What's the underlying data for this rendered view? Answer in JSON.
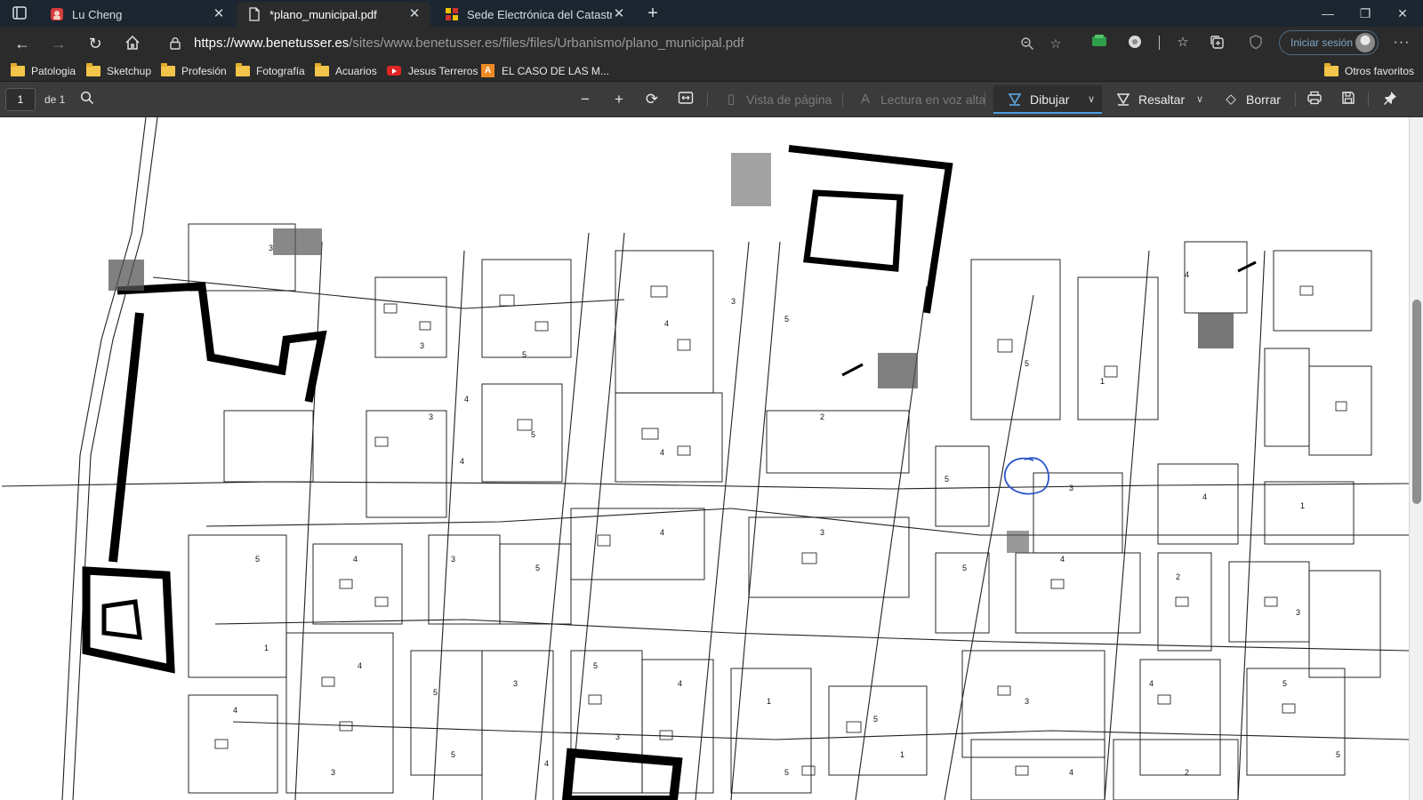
{
  "tabs": [
    {
      "title": "Lu Cheng",
      "favicon": "profile-favicon",
      "active": false
    },
    {
      "title": "*plano_municipal.pdf",
      "favicon": "document-favicon",
      "active": true
    },
    {
      "title": "Sede Electrónica del Catastro - I",
      "favicon": "catastro-favicon",
      "active": false
    }
  ],
  "address": {
    "host": "https://www.benetusser.es",
    "path": "/sites/www.benetusser.es/files/files/Urbanismo/plano_municipal.pdf"
  },
  "profile": {
    "signin_label": "Iniciar sesión"
  },
  "favorites": [
    {
      "label": "Patologia",
      "icon": "folder-icon"
    },
    {
      "label": "Sketchup",
      "icon": "folder-icon"
    },
    {
      "label": "Profesión",
      "icon": "folder-icon"
    },
    {
      "label": "Fotografía",
      "icon": "folder-icon"
    },
    {
      "label": "Acuarios",
      "icon": "folder-icon"
    },
    {
      "label": "Jesus Terreros",
      "icon": "youtube-icon"
    },
    {
      "label": "EL CASO DE LAS M...",
      "icon": "bookmark-icon"
    },
    {
      "label": "Otros favoritos",
      "icon": "folder-icon"
    }
  ],
  "pdf_toolbar": {
    "page_current": "1",
    "page_of": "de 1",
    "page_view_label": "Vista de página",
    "read_aloud_label": "Lectura en voz alta",
    "draw_label": "Dibujar",
    "highlight_label": "Resaltar",
    "erase_label": "Borrar"
  },
  "colors": {
    "tabstrip": "#1b2631",
    "toolbar": "#2b2b2b",
    "pdf_toolbar": "#3b3b3b",
    "accent": "#4a9de0",
    "ink_annotation": "#2b55c8"
  },
  "map": {
    "block_numbers": [
      "3",
      "3",
      "4",
      "5",
      "4",
      "3",
      "5",
      "5",
      "1",
      "4",
      "3",
      "4",
      "5",
      "4",
      "2",
      "5",
      "3",
      "4",
      "1",
      "5",
      "4",
      "3",
      "5",
      "4",
      "3",
      "5",
      "4",
      "2",
      "3",
      "1",
      "4",
      "5",
      "3",
      "5",
      "4",
      "1",
      "5",
      "3",
      "4",
      "5",
      "4",
      "3",
      "5",
      "4",
      "3",
      "5",
      "1",
      "4",
      "2",
      "5"
    ]
  }
}
